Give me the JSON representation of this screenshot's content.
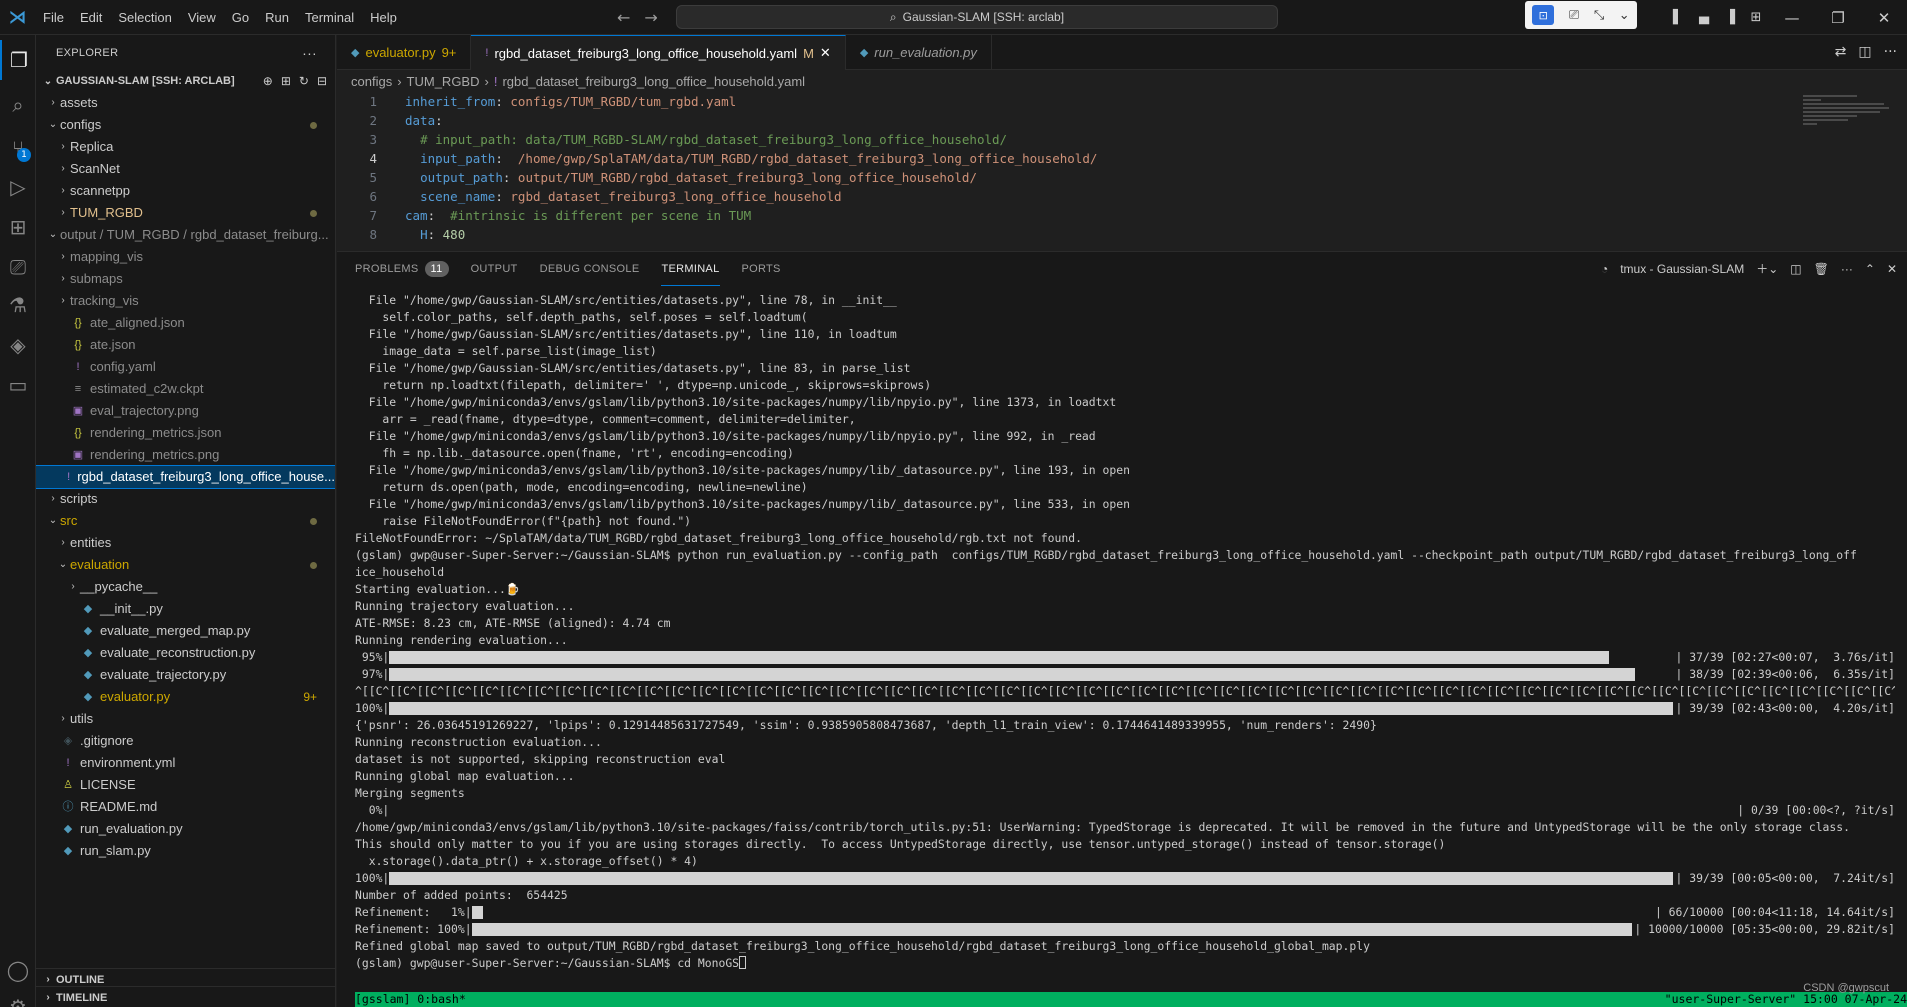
{
  "titlebar": {
    "menu": [
      "File",
      "Edit",
      "Selection",
      "View",
      "Go",
      "Run",
      "Terminal",
      "Help"
    ],
    "search_text": "Gaussian-SLAM [SSH: arclab]"
  },
  "activity_badge": "1",
  "sidebar": {
    "title": "EXPLORER",
    "workspace": "GAUSSIAN-SLAM [SSH: ARCLAB]",
    "tree": [
      {
        "label": "assets",
        "indent": 1,
        "twist": "›",
        "icon": "",
        "cls": ""
      },
      {
        "label": "configs",
        "indent": 1,
        "twist": "⌄",
        "icon": "",
        "cls": "",
        "dot": true
      },
      {
        "label": "Replica",
        "indent": 2,
        "twist": "›",
        "icon": "",
        "cls": ""
      },
      {
        "label": "ScanNet",
        "indent": 2,
        "twist": "›",
        "icon": "",
        "cls": ""
      },
      {
        "label": "scannetpp",
        "indent": 2,
        "twist": "›",
        "icon": "",
        "cls": ""
      },
      {
        "label": "TUM_RGBD",
        "indent": 2,
        "twist": "›",
        "icon": "",
        "cls": "modified",
        "dot": true
      },
      {
        "label": "output / TUM_RGBD / rgbd_dataset_freiburg...",
        "indent": 1,
        "twist": "⌄",
        "icon": "",
        "cls": "ignored"
      },
      {
        "label": "mapping_vis",
        "indent": 2,
        "twist": "›",
        "icon": "",
        "cls": "ignored"
      },
      {
        "label": "submaps",
        "indent": 2,
        "twist": "›",
        "icon": "",
        "cls": "ignored"
      },
      {
        "label": "tracking_vis",
        "indent": 2,
        "twist": "›",
        "icon": "",
        "cls": "ignored"
      },
      {
        "label": "ate_aligned.json",
        "indent": 2,
        "twist": "",
        "icon": "{}",
        "iconcls": "ic-json",
        "cls": "ignored"
      },
      {
        "label": "ate.json",
        "indent": 2,
        "twist": "",
        "icon": "{}",
        "iconcls": "ic-json",
        "cls": "ignored"
      },
      {
        "label": "config.yaml",
        "indent": 2,
        "twist": "",
        "icon": "!",
        "iconcls": "ic-yaml",
        "cls": "ignored"
      },
      {
        "label": "estimated_c2w.ckpt",
        "indent": 2,
        "twist": "",
        "icon": "≡",
        "iconcls": "ic-ckpt",
        "cls": "ignored"
      },
      {
        "label": "eval_trajectory.png",
        "indent": 2,
        "twist": "",
        "icon": "▣",
        "iconcls": "ic-png",
        "cls": "ignored"
      },
      {
        "label": "rendering_metrics.json",
        "indent": 2,
        "twist": "",
        "icon": "{}",
        "iconcls": "ic-json",
        "cls": "ignored"
      },
      {
        "label": "rendering_metrics.png",
        "indent": 2,
        "twist": "",
        "icon": "▣",
        "iconcls": "ic-png",
        "cls": "ignored"
      },
      {
        "label": "rgbd_dataset_freiburg3_long_office_house...",
        "indent": 2,
        "twist": "",
        "icon": "!",
        "iconcls": "ic-yaml",
        "cls": "selected"
      },
      {
        "label": "scripts",
        "indent": 1,
        "twist": "›",
        "icon": "",
        "cls": ""
      },
      {
        "label": "src",
        "indent": 1,
        "twist": "⌄",
        "icon": "",
        "cls": "warn",
        "dot": true
      },
      {
        "label": "entities",
        "indent": 2,
        "twist": "›",
        "icon": "",
        "cls": ""
      },
      {
        "label": "evaluation",
        "indent": 2,
        "twist": "⌄",
        "icon": "",
        "cls": "warn",
        "dot": true
      },
      {
        "label": "__pycache__",
        "indent": 3,
        "twist": "›",
        "icon": "",
        "cls": ""
      },
      {
        "label": "__init__.py",
        "indent": 3,
        "twist": "",
        "icon": "◆",
        "iconcls": "ic-py",
        "cls": ""
      },
      {
        "label": "evaluate_merged_map.py",
        "indent": 3,
        "twist": "",
        "icon": "◆",
        "iconcls": "ic-py",
        "cls": ""
      },
      {
        "label": "evaluate_reconstruction.py",
        "indent": 3,
        "twist": "",
        "icon": "◆",
        "iconcls": "ic-py",
        "cls": ""
      },
      {
        "label": "evaluate_trajectory.py",
        "indent": 3,
        "twist": "",
        "icon": "◆",
        "iconcls": "ic-py",
        "cls": ""
      },
      {
        "label": "evaluator.py",
        "indent": 3,
        "twist": "",
        "icon": "◆",
        "iconcls": "ic-py",
        "cls": "warn",
        "count": "9+"
      },
      {
        "label": "utils",
        "indent": 2,
        "twist": "›",
        "icon": "",
        "cls": ""
      },
      {
        "label": ".gitignore",
        "indent": 1,
        "twist": "",
        "icon": "◈",
        "iconcls": "ic-git",
        "cls": ""
      },
      {
        "label": "environment.yml",
        "indent": 1,
        "twist": "",
        "icon": "!",
        "iconcls": "ic-yaml",
        "cls": ""
      },
      {
        "label": "LICENSE",
        "indent": 1,
        "twist": "",
        "icon": "♙",
        "iconcls": "ic-lic",
        "cls": ""
      },
      {
        "label": "README.md",
        "indent": 1,
        "twist": "",
        "icon": "ⓘ",
        "iconcls": "ic-md",
        "cls": ""
      },
      {
        "label": "run_evaluation.py",
        "indent": 1,
        "twist": "",
        "icon": "◆",
        "iconcls": "ic-py",
        "cls": ""
      },
      {
        "label": "run_slam.py",
        "indent": 1,
        "twist": "",
        "icon": "◆",
        "iconcls": "ic-py",
        "cls": ""
      }
    ],
    "outline": "OUTLINE",
    "timeline": "TIMELINE"
  },
  "editor": {
    "tabs": [
      {
        "label": "evaluator.py",
        "suffix": "9+",
        "icon": "◆",
        "iconcls": "ic-py",
        "state": "warn"
      },
      {
        "label": "rgbd_dataset_freiburg3_long_office_household.yaml",
        "suffix": "M",
        "icon": "!",
        "iconcls": "ic-yaml",
        "state": "active"
      },
      {
        "label": "run_evaluation.py",
        "suffix": "",
        "icon": "◆",
        "iconcls": "ic-py",
        "state": "italic"
      }
    ],
    "breadcrumb": [
      "configs",
      "TUM_RGBD",
      "rgbd_dataset_freiburg3_long_office_household.yaml"
    ],
    "lines": [
      {
        "n": "1",
        "parts": [
          [
            "k",
            "inherit_from"
          ],
          [
            "",
            ": "
          ],
          [
            "s",
            "configs/TUM_RGBD/tum_rgbd.yaml"
          ]
        ]
      },
      {
        "n": "2",
        "parts": [
          [
            "k",
            "data"
          ],
          [
            "",
            ":"
          ]
        ]
      },
      {
        "n": "3",
        "parts": [
          [
            "",
            "  "
          ],
          [
            "c",
            "# input_path: data/TUM_RGBD-SLAM/rgbd_dataset_freiburg3_long_office_household/"
          ]
        ]
      },
      {
        "n": "4",
        "parts": [
          [
            "",
            "  "
          ],
          [
            "k",
            "input_path"
          ],
          [
            "",
            ":  "
          ],
          [
            "s",
            "/home/gwp/SplaTAM/data/TUM_RGBD/rgbd_dataset_freiburg3_long_office_household/"
          ]
        ]
      },
      {
        "n": "5",
        "parts": [
          [
            "",
            "  "
          ],
          [
            "k",
            "output_path"
          ],
          [
            "",
            ": "
          ],
          [
            "s",
            "output/TUM_RGBD/rgbd_dataset_freiburg3_long_office_household/"
          ]
        ]
      },
      {
        "n": "6",
        "parts": [
          [
            "",
            "  "
          ],
          [
            "k",
            "scene_name"
          ],
          [
            "",
            ": "
          ],
          [
            "s",
            "rgbd_dataset_freiburg3_long_office_household"
          ]
        ]
      },
      {
        "n": "7",
        "parts": [
          [
            "k",
            "cam"
          ],
          [
            "",
            ":  "
          ],
          [
            "c",
            "#intrinsic is different per scene in TUM"
          ]
        ]
      },
      {
        "n": "8",
        "parts": [
          [
            "",
            "  "
          ],
          [
            "k",
            "H"
          ],
          [
            "",
            ": "
          ],
          [
            "n",
            "480"
          ]
        ]
      }
    ],
    "current_line": "4"
  },
  "panel": {
    "tabs": [
      {
        "label": "PROBLEMS",
        "count": "11"
      },
      {
        "label": "OUTPUT",
        "count": ""
      },
      {
        "label": "DEBUG CONSOLE",
        "count": ""
      },
      {
        "label": "TERMINAL",
        "count": ""
      },
      {
        "label": "PORTS",
        "count": ""
      }
    ],
    "active_tab": "TERMINAL",
    "terminal_name": "tmux - Gaussian-SLAM"
  },
  "terminal": [
    {
      "text": "  File \"/home/gwp/Gaussian-SLAM/src/entities/datasets.py\", line 78, in __init__"
    },
    {
      "text": "    self.color_paths, self.depth_paths, self.poses = self.loadtum("
    },
    {
      "text": "  File \"/home/gwp/Gaussian-SLAM/src/entities/datasets.py\", line 110, in loadtum"
    },
    {
      "text": "    image_data = self.parse_list(image_list)"
    },
    {
      "text": "  File \"/home/gwp/Gaussian-SLAM/src/entities/datasets.py\", line 83, in parse_list"
    },
    {
      "text": "    return np.loadtxt(filepath, delimiter=' ', dtype=np.unicode_, skiprows=skiprows)"
    },
    {
      "text": "  File \"/home/gwp/miniconda3/envs/gslam/lib/python3.10/site-packages/numpy/lib/npyio.py\", line 1373, in loadtxt"
    },
    {
      "text": "    arr = _read(fname, dtype=dtype, comment=comment, delimiter=delimiter,"
    },
    {
      "text": "  File \"/home/gwp/miniconda3/envs/gslam/lib/python3.10/site-packages/numpy/lib/npyio.py\", line 992, in _read"
    },
    {
      "text": "    fh = np.lib._datasource.open(fname, 'rt', encoding=encoding)"
    },
    {
      "text": "  File \"/home/gwp/miniconda3/envs/gslam/lib/python3.10/site-packages/numpy/lib/_datasource.py\", line 193, in open"
    },
    {
      "text": "    return ds.open(path, mode, encoding=encoding, newline=newline)"
    },
    {
      "text": "  File \"/home/gwp/miniconda3/envs/gslam/lib/python3.10/site-packages/numpy/lib/_datasource.py\", line 533, in open"
    },
    {
      "text": "    raise FileNotFoundError(f\"{path} not found.\")"
    },
    {
      "text": "FileNotFoundError: ~/SplaTAM/data/TUM_RGBD/rgbd_dataset_freiburg3_long_office_household/rgb.txt not found."
    },
    {
      "text": "(gslam) gwp@user-Super-Server:~/Gaussian-SLAM$ python run_evaluation.py --config_path  configs/TUM_RGBD/rgbd_dataset_freiburg3_long_office_household.yaml --checkpoint_path output/TUM_RGBD/rgbd_dataset_freiburg3_long_off"
    },
    {
      "text": "ice_household"
    },
    {
      "text": "Starting evaluation...🍺"
    },
    {
      "text": "Running trajectory evaluation..."
    },
    {
      "text": "ATE-RMSE: 8.23 cm, ATE-RMSE (aligned): 4.74 cm"
    },
    {
      "text": "Running rendering evaluation..."
    },
    {
      "text": " 95%|",
      "bar": 0.95,
      "right": "| 37/39 [02:27<00:07,  3.76s/it]"
    },
    {
      "text": " 97%|",
      "bar": 0.97,
      "right": "| 38/39 [02:39<00:06,  6.35s/it]"
    },
    {
      "text": "^[[C^[[C^[[C^[[C^[[C^[[C^[[C^[[C^[[C^[[C^[[C^[[C^[[C^[[C^[[C^[[C^[[C^[[C^[[C^[[C^[[C^[[C^[[C^[[C^[[C^[[C^[[C^[[C^[[C^[[C^[[C^[[C^[[C^[[C^[[C^[[C^[[C^[[C^[[C^[[C^[[C^[[C^[[C^[[C^[[C^[[C^[[C^[[C^[[C^[[C^[[C^[[C^[[C^[[C^[[C^[[C^[[C^[[C^[[C^[[C^[[C^[["
    },
    {
      "text": "100%|",
      "bar": 1.0,
      "right": "| 39/39 [02:43<00:00,  4.20s/it]"
    },
    {
      "text": "{'psnr': 26.03645191269227, 'lpips': 0.12914485631727549, 'ssim': 0.9385905808473687, 'depth_l1_train_view': 0.1744641489339955, 'num_renders': 2490}"
    },
    {
      "text": "Running reconstruction evaluation..."
    },
    {
      "text": "dataset is not supported, skipping reconstruction eval"
    },
    {
      "text": "Running global map evaluation..."
    },
    {
      "text": "Merging segments"
    },
    {
      "text": "  0%|",
      "bar": 0.0,
      "right": "| 0/39 [00:00<?, ?it/s]"
    },
    {
      "text": "/home/gwp/miniconda3/envs/gslam/lib/python3.10/site-packages/faiss/contrib/torch_utils.py:51: UserWarning: TypedStorage is deprecated. It will be removed in the future and UntypedStorage will be the only storage class."
    },
    {
      "text": "This should only matter to you if you are using storages directly.  To access UntypedStorage directly, use tensor.untyped_storage() instead of tensor.storage()"
    },
    {
      "text": "  x.storage().data_ptr() + x.storage_offset() * 4)"
    },
    {
      "text": "100%|",
      "bar": 1.0,
      "right": "| 39/39 [00:05<00:00,  7.24it/s]"
    },
    {
      "text": "Number of added points:  654425"
    },
    {
      "text": "Refinement:   1%|",
      "bar": 0.01,
      "right": "| 66/10000 [00:04<11:18, 14.64it/s]"
    },
    {
      "text": "Refinement: 100%|",
      "bar": 1.0,
      "right": "| 10000/10000 [05:35<00:00, 29.82it/s]"
    },
    {
      "text": "Refined global map saved to output/TUM_RGBD/rgbd_dataset_freiburg3_long_office_household/rgbd_dataset_freiburg3_long_office_household_global_map.ply"
    },
    {
      "text": "(gslam) gwp@user-Super-Server:~/Gaussian-SLAM$ cd MonoGS",
      "cursor": true
    }
  ],
  "tmux": {
    "left": "[gsslam] 0:bash*",
    "right": "\"user-Super-Server\" 15:00 07-Apr-24"
  },
  "watermark": "CSDN @gwpscut"
}
